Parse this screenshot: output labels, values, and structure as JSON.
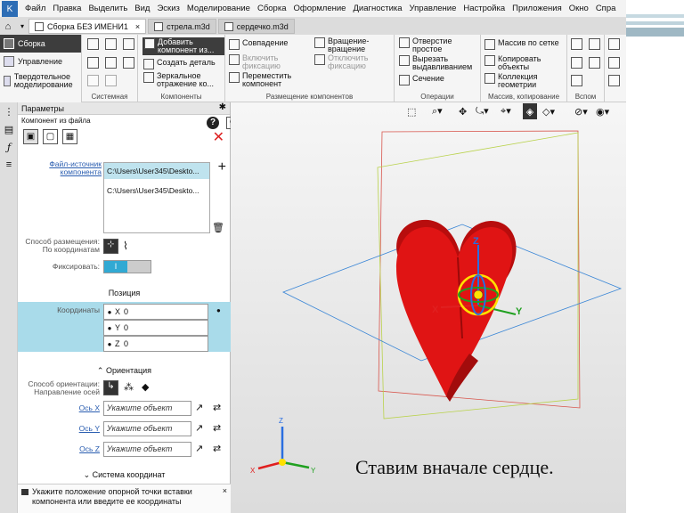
{
  "menu": [
    "Файл",
    "Правка",
    "Выделить",
    "Вид",
    "Эскиз",
    "Моделирование",
    "Сборка",
    "Оформление",
    "Диагностика",
    "Управление",
    "Настройка",
    "Приложения",
    "Окно",
    "Спра"
  ],
  "tabs": [
    {
      "label": "Сборка БЕЗ ИМЕНИ1",
      "close": "×",
      "active": true
    },
    {
      "label": "стрела.m3d",
      "active": false
    },
    {
      "label": "сердечко.m3d",
      "active": false
    }
  ],
  "ribbon": {
    "left": [
      "Сборка",
      "Управление",
      "Твердотельное моделирование"
    ],
    "groups": {
      "system": "Системная",
      "components": "Компоненты",
      "placement": "Размещение компонентов",
      "operations": "Операции",
      "mass": "Массив, копирование",
      "aux": "Вспом"
    },
    "buttons": {
      "add_component": "Добавить компонент из...",
      "create_part": "Создать деталь",
      "mirror": "Зеркальное отражение ко...",
      "coincidence": "Совпадение",
      "enable_fix": "Включить фиксацию",
      "move_component": "Переместить компонент",
      "rotation": "Вращение-вращение",
      "disable_fix": "Отключить фиксацию",
      "hole": "Отверстие простое",
      "cut_extrude": "Вырезать выдавливанием",
      "section": "Сечение",
      "mesh_array": "Массив по сетке",
      "copy_objects": "Копировать объекты",
      "geometry_collection": "Коллекция геометрии"
    }
  },
  "panel": {
    "title": "Параметры",
    "subtitle": "Компонент из файла",
    "source_label": "Файл-источник компонента",
    "files": [
      "C:\\Users\\User345\\Deskto...",
      "C:\\Users\\User345\\Deskto..."
    ],
    "placement_label": "Способ размещения:",
    "placement_value": "По координатам",
    "fix_label": "Фиксировать:",
    "fix_state": "I",
    "position_title": "Позиция",
    "coords_label": "Координаты",
    "coords": [
      {
        "axis": "X",
        "value": "0"
      },
      {
        "axis": "Y",
        "value": "0"
      },
      {
        "axis": "Z",
        "value": "0"
      }
    ],
    "orientation_title": "Ориентация",
    "orient_method_label": "Способ ориентации:",
    "orient_method_value": "Направление осей",
    "axes": [
      {
        "label": "Ось X",
        "placeholder": "Укажите объект"
      },
      {
        "label": "Ось Y",
        "placeholder": "Укажите объект"
      },
      {
        "label": "Ось Z",
        "placeholder": "Укажите объект"
      }
    ],
    "coord_system_title": "Система координат",
    "hint": "Укажите положение опорной точки вставки компонента или введите ее координаты"
  },
  "viewport": {
    "triad": {
      "x": "X",
      "y": "Y",
      "z": "Z"
    },
    "caption": "Ставим вначале сердце."
  },
  "colors": {
    "accent": "#31a9d3",
    "heart": "#e01212",
    "band": "#a9dbea"
  }
}
